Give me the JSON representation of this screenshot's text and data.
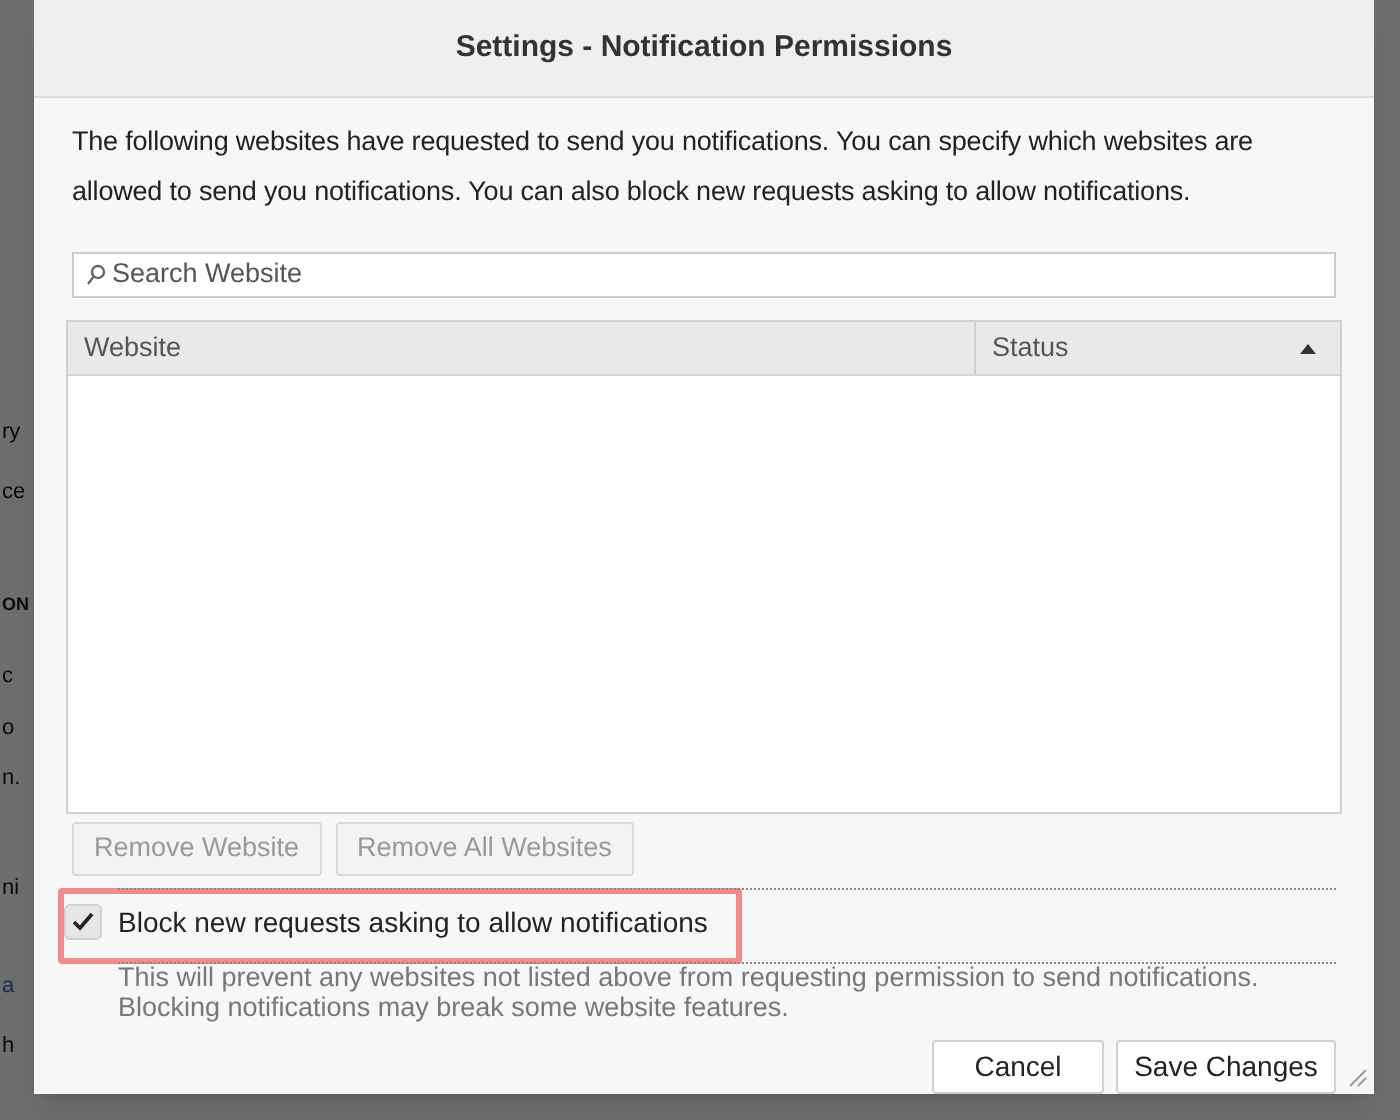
{
  "background_fragments": [
    "ry",
    "ce",
    "ON",
    "c",
    "o",
    "n.",
    "ni",
    "a",
    "h"
  ],
  "window": {
    "title": "Settings - Notification Permissions"
  },
  "description": "The following websites have requested to send you notifications. You can specify which websites are allowed to send you notifications. You can also block new requests asking to allow notifications.",
  "search": {
    "placeholder": "Search Website"
  },
  "table": {
    "columns": [
      {
        "label": "Website",
        "sorted": false
      },
      {
        "label": "Status",
        "sorted": true
      }
    ]
  },
  "list_buttons": [
    "Remove Website",
    "Remove All Websites"
  ],
  "block_checkbox": {
    "label": "Block new requests asking to allow notifications",
    "checked": true
  },
  "note": "This will prevent any websites not listed above from requesting permission to send notifications. Blocking notifications may break some website features.",
  "buttons": [
    "Cancel",
    "Save Changes"
  ]
}
